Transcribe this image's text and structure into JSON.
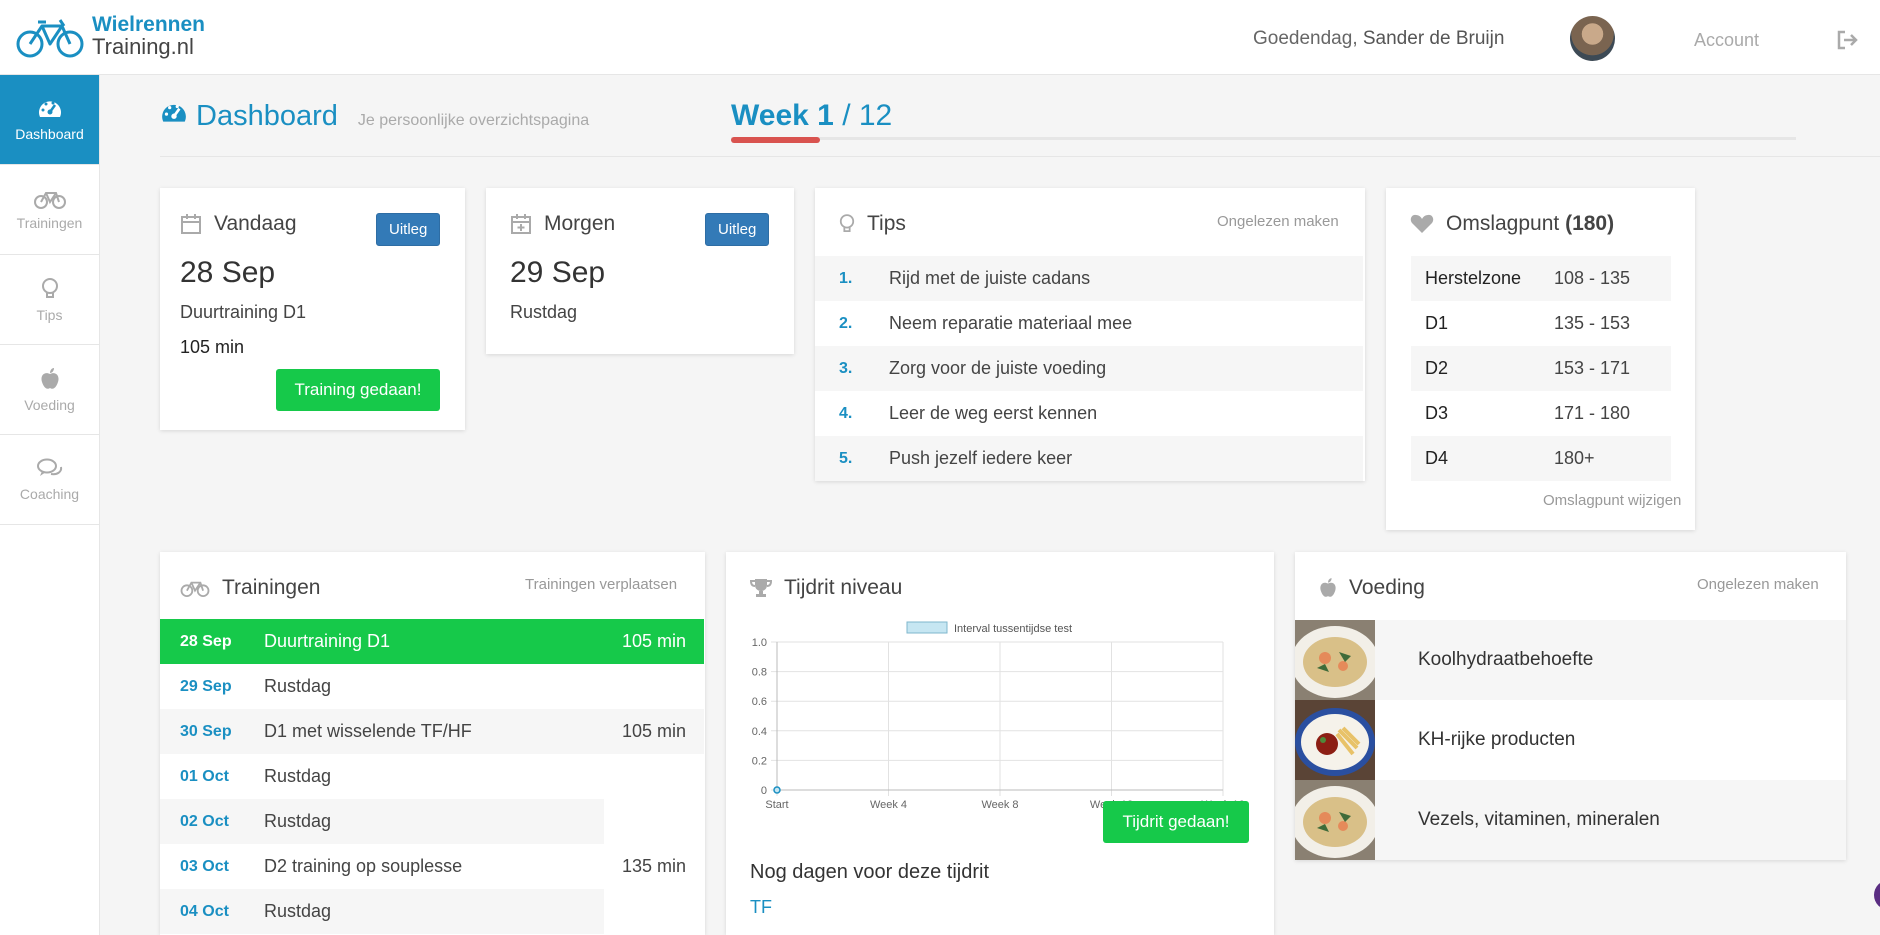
{
  "header": {
    "logo_line1": "Wielrennen",
    "logo_line2": "Training.nl",
    "greeting": "Goedendag,",
    "user_name": "Sander de Bruijn",
    "account_label": "Account"
  },
  "sidebar": {
    "items": [
      {
        "label": "Dashboard",
        "icon": "dashboard-icon"
      },
      {
        "label": "Trainingen",
        "icon": "bicycle-icon"
      },
      {
        "label": "Tips",
        "icon": "lightbulb-icon"
      },
      {
        "label": "Voeding",
        "icon": "apple-icon"
      },
      {
        "label": "Coaching",
        "icon": "chat-icon"
      }
    ]
  },
  "page": {
    "title": "Dashboard",
    "subtitle": "Je persoonlijke overzichtspagina",
    "week_current": "Week 1",
    "week_total": "/ 12",
    "week_progress": 0.0833
  },
  "today": {
    "title": "Vandaag",
    "button": "Uitleg",
    "date": "28 Sep",
    "training": "Duurtraining D1",
    "duration": "105 min",
    "done_button": "Training gedaan!"
  },
  "tomorrow": {
    "title": "Morgen",
    "button": "Uitleg",
    "date": "29 Sep",
    "training": "Rustdag"
  },
  "tips": {
    "title": "Tips",
    "action": "Ongelezen maken",
    "items": [
      {
        "num": "1.",
        "text": "Rijd met de juiste cadans"
      },
      {
        "num": "2.",
        "text": "Neem reparatie materiaal mee"
      },
      {
        "num": "3.",
        "text": "Zorg voor de juiste voeding"
      },
      {
        "num": "4.",
        "text": "Leer de weg eerst kennen"
      },
      {
        "num": "5.",
        "text": "Push jezelf iedere keer"
      }
    ]
  },
  "omslagpunt": {
    "title": "Omslagpunt",
    "value": "(180)",
    "zones": [
      {
        "name": "Herstelzone",
        "range": "108 - 135"
      },
      {
        "name": "D1",
        "range": "135 - 153"
      },
      {
        "name": "D2",
        "range": "153 - 171"
      },
      {
        "name": "D3",
        "range": "171 - 180"
      },
      {
        "name": "D4",
        "range": "180+"
      }
    ],
    "action": "Omslagpunt wijzigen"
  },
  "trainingen": {
    "title": "Trainingen",
    "action": "Trainingen verplaatsen",
    "rows": [
      {
        "date": "28 Sep",
        "name": "Duurtraining D1",
        "min": "105 min"
      },
      {
        "date": "29 Sep",
        "name": "Rustdag",
        "min": ""
      },
      {
        "date": "30 Sep",
        "name": "D1 met wisselende TF/HF",
        "min": "105 min"
      },
      {
        "date": "01 Oct",
        "name": "Rustdag",
        "min": ""
      },
      {
        "date": "02 Oct",
        "name": "Rustdag",
        "min": ""
      },
      {
        "date": "03 Oct",
        "name": "D2 training op souplesse",
        "min": "135 min"
      },
      {
        "date": "04 Oct",
        "name": "Rustdag",
        "min": ""
      }
    ]
  },
  "tijdrit": {
    "title": "Tijdrit niveau",
    "done_button": "Tijdrit gedaan!",
    "days_heading": "Nog dagen voor deze tijdrit",
    "days_value": "TF"
  },
  "chart_data": {
    "type": "line",
    "categories": [
      "Start",
      "Week 4",
      "Week 8",
      "Week 12",
      "Week 16"
    ],
    "series": [
      {
        "name": "Interval tussentijdse test",
        "values": [
          0
        ]
      }
    ],
    "yticks": [
      "0",
      "0.2",
      "0.4",
      "0.6",
      "0.8",
      "1.0"
    ],
    "ylim": [
      0,
      1.0
    ],
    "grid": true,
    "legend": "top",
    "color": "#c6e6f2"
  },
  "voeding": {
    "title": "Voeding",
    "action": "Ongelezen maken",
    "items": [
      {
        "label": "Koolhydraatbehoefte"
      },
      {
        "label": "KH-rijke producten"
      },
      {
        "label": "Vezels, vitaminen, mineralen"
      }
    ]
  },
  "colors": {
    "accent": "#1a8fc2",
    "success": "#16c94a",
    "primary_button": "#337ab7",
    "progress": "#d9534f"
  }
}
